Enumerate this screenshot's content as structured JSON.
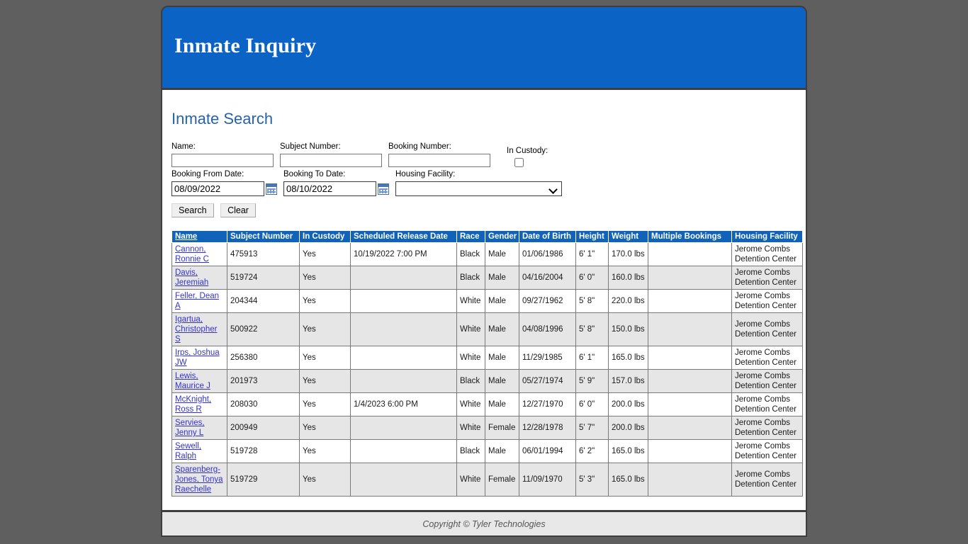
{
  "banner": {
    "title": "Inmate Inquiry"
  },
  "search": {
    "section_title": "Inmate Search",
    "name_label": "Name:",
    "name_value": "",
    "subject_label": "Subject Number:",
    "subject_value": "",
    "booking_label": "Booking Number:",
    "booking_value": "",
    "custody_label": "In Custody:",
    "custody_checked": false,
    "from_label": "Booking From Date:",
    "from_value": "08/09/2022",
    "to_label": "Booking To Date:",
    "to_value": "08/10/2022",
    "facility_label": "Housing Facility:",
    "facility_value": "",
    "facility_options": [
      ""
    ],
    "search_button": "Search",
    "clear_button": "Clear"
  },
  "table": {
    "headers": [
      "Name",
      "Subject Number",
      "In Custody",
      "Scheduled Release Date",
      "Race",
      "Gender",
      "Date of Birth",
      "Height",
      "Weight",
      "Multiple Bookings",
      "Housing Facility"
    ],
    "rows": [
      {
        "name": "Cannon, Ronnie C",
        "subject": "475913",
        "custody": "Yes",
        "release": "10/19/2022 7:00 PM",
        "race": "Black",
        "gender": "Male",
        "dob": "01/06/1986",
        "height": "6' 1\"",
        "weight": "170.0 lbs",
        "multiple": "",
        "facility": "Jerome Combs Detention Center"
      },
      {
        "name": "Davis, Jeremiah",
        "subject": "519724",
        "custody": "Yes",
        "release": "",
        "race": "Black",
        "gender": "Male",
        "dob": "04/16/2004",
        "height": "6' 0\"",
        "weight": "160.0 lbs",
        "multiple": "",
        "facility": "Jerome Combs Detention Center"
      },
      {
        "name": "Feller, Dean A",
        "subject": "204344",
        "custody": "Yes",
        "release": "",
        "race": "White",
        "gender": "Male",
        "dob": "09/27/1962",
        "height": "5' 8\"",
        "weight": "220.0 lbs",
        "multiple": "",
        "facility": "Jerome Combs Detention Center"
      },
      {
        "name": "Igartua, Christopher S",
        "subject": "500922",
        "custody": "Yes",
        "release": "",
        "race": "White",
        "gender": "Male",
        "dob": "04/08/1996",
        "height": "5' 8\"",
        "weight": "150.0 lbs",
        "multiple": "",
        "facility": "Jerome Combs Detention Center"
      },
      {
        "name": "Irps, Joshua JW",
        "subject": "256380",
        "custody": "Yes",
        "release": "",
        "race": "White",
        "gender": "Male",
        "dob": "11/29/1985",
        "height": "6' 1\"",
        "weight": "165.0 lbs",
        "multiple": "",
        "facility": "Jerome Combs Detention Center"
      },
      {
        "name": "Lewis, Maurice J",
        "subject": "201973",
        "custody": "Yes",
        "release": "",
        "race": "Black",
        "gender": "Male",
        "dob": "05/27/1974",
        "height": "5' 9\"",
        "weight": "157.0 lbs",
        "multiple": "",
        "facility": "Jerome Combs Detention Center"
      },
      {
        "name": "McKnight, Ross R",
        "subject": "208030",
        "custody": "Yes",
        "release": "1/4/2023 6:00 PM",
        "race": "White",
        "gender": "Male",
        "dob": "12/27/1970",
        "height": "6' 0\"",
        "weight": "200.0 lbs",
        "multiple": "",
        "facility": "Jerome Combs Detention Center"
      },
      {
        "name": "Servies, Jenny L",
        "subject": "200949",
        "custody": "Yes",
        "release": "",
        "race": "White",
        "gender": "Female",
        "dob": "12/28/1978",
        "height": "5' 7\"",
        "weight": "200.0 lbs",
        "multiple": "",
        "facility": "Jerome Combs Detention Center"
      },
      {
        "name": "Sewell, Ralph",
        "subject": "519728",
        "custody": "Yes",
        "release": "",
        "race": "Black",
        "gender": "Male",
        "dob": "06/01/1994",
        "height": "6' 2\"",
        "weight": "165.0 lbs",
        "multiple": "",
        "facility": "Jerome Combs Detention Center"
      },
      {
        "name": "Sparenberg-Jones, Tonya Raechelle",
        "subject": "519729",
        "custody": "Yes",
        "release": "",
        "race": "White",
        "gender": "Female",
        "dob": "11/09/1970",
        "height": "5' 3\"",
        "weight": "165.0 lbs",
        "multiple": "",
        "facility": "Jerome Combs Detention Center"
      }
    ]
  },
  "footer": {
    "copyright": "Copyright © Tyler Technologies"
  },
  "colors": {
    "banner_blue": "#0b63c5",
    "table_header_blue": "#1063b8",
    "link_blue": "#3333cc",
    "page_bg": "#5f5f5f"
  }
}
